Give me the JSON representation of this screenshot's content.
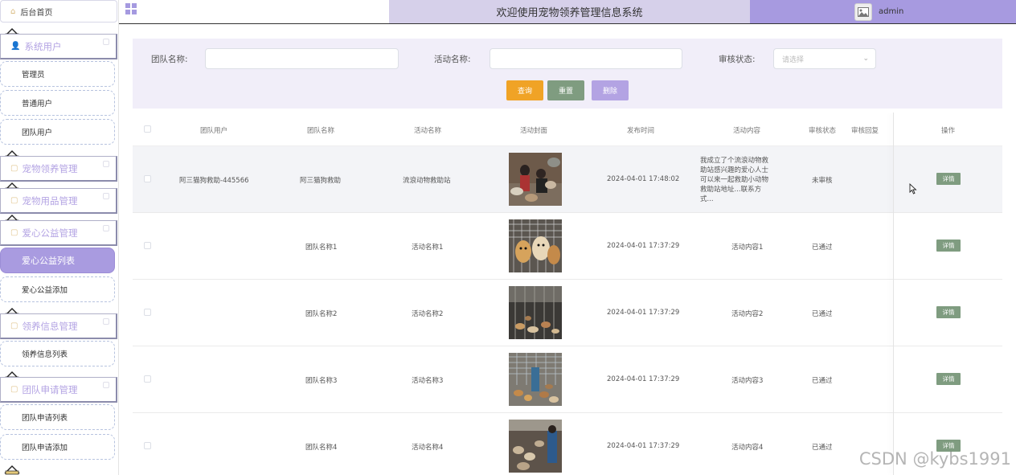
{
  "sidebar": {
    "home_label": "后台首页",
    "groups": [
      {
        "label": "系统用户",
        "items": [
          "管理员",
          "普通用户",
          "团队用户"
        ]
      },
      {
        "label": "宠物领养管理",
        "items": []
      },
      {
        "label": "宠物用品管理",
        "items": []
      },
      {
        "label": "爱心公益管理",
        "items": [
          "爱心公益列表",
          "爱心公益添加"
        ]
      },
      {
        "label": "领养信息管理",
        "items": [
          "领养信息列表"
        ]
      },
      {
        "label": "团队申请管理",
        "items": [
          "团队申请列表",
          "团队申请添加"
        ]
      }
    ]
  },
  "header": {
    "title": "欢迎使用宠物领养管理信息系统",
    "username": "admin"
  },
  "search": {
    "team_name_label": "团队名称:",
    "activity_name_label": "活动名称:",
    "status_label": "审核状态:",
    "status_placeholder": "请选择",
    "query_button": "查询",
    "reset_button": "重置",
    "delete_button": "删除"
  },
  "table": {
    "columns": [
      "团队用户",
      "团队名称",
      "活动名称",
      "活动封面",
      "发布时间",
      "活动内容",
      "审核状态",
      "审核回复",
      "操作"
    ],
    "rows": [
      {
        "team_user": "阿三猫狗救助-445566",
        "team_name": "阿三猫狗救助",
        "activity_name": "流浪动物救助站",
        "time": "2024-04-01 17:48:02",
        "content": "我成立了个流浪动物救助站感兴趣的爱心人士可以来一起救助小动物 救助站地址...联系方式...",
        "status": "未审核",
        "reply": "",
        "action": "详情"
      },
      {
        "team_user": "",
        "team_name": "团队名称1",
        "activity_name": "活动名称1",
        "time": "2024-04-01 17:37:29",
        "content": "活动内容1",
        "status": "已通过",
        "reply": "",
        "action": "详情"
      },
      {
        "team_user": "",
        "team_name": "团队名称2",
        "activity_name": "活动名称2",
        "time": "2024-04-01 17:37:29",
        "content": "活动内容2",
        "status": "已通过",
        "reply": "",
        "action": "详情"
      },
      {
        "team_user": "",
        "team_name": "团队名称3",
        "activity_name": "活动名称3",
        "time": "2024-04-01 17:37:29",
        "content": "活动内容3",
        "status": "已通过",
        "reply": "",
        "action": "详情"
      },
      {
        "team_user": "",
        "team_name": "团队名称4",
        "activity_name": "活动名称4",
        "time": "2024-04-01 17:37:29",
        "content": "活动内容4",
        "status": "已通过",
        "reply": "",
        "action": "详情"
      }
    ]
  },
  "watermark": "CSDN @kybs1991",
  "colors": {
    "accent": "#a79ae0",
    "query": "#f0a326",
    "reset": "#7f9c80",
    "delete": "#b3a3e3"
  }
}
